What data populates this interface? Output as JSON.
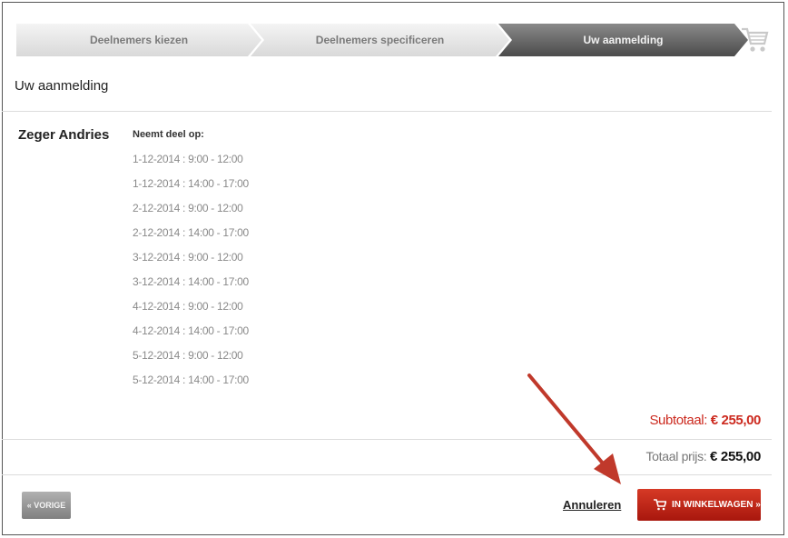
{
  "steps": [
    {
      "label": "Deelnemers kiezen",
      "state": "done"
    },
    {
      "label": "Deelnemers specificeren",
      "state": "done"
    },
    {
      "label": "Uw aanmelding",
      "state": "active"
    }
  ],
  "cart_icon": "shopping-cart-icon",
  "page_title": "Uw aanmelding",
  "participant": {
    "name": "Zeger Andries",
    "takes_part_label": "Neemt deel op:",
    "sessions": [
      "1-12-2014 : 9:00 - 12:00",
      "1-12-2014 : 14:00 - 17:00",
      "2-12-2014 : 9:00 - 12:00",
      "2-12-2014 : 14:00 - 17:00",
      "3-12-2014 : 9:00 - 12:00",
      "3-12-2014 : 14:00 - 17:00",
      "4-12-2014 : 9:00 - 12:00",
      "4-12-2014 : 14:00 - 17:00",
      "5-12-2014 : 9:00 - 12:00",
      "5-12-2014 : 14:00 - 17:00"
    ]
  },
  "subtotal": {
    "label": "Subtotaal:",
    "amount": "€ 255,00"
  },
  "total": {
    "label": "Totaal prijs:",
    "amount": "€ 255,00"
  },
  "buttons": {
    "previous": "« VORIGE",
    "cancel": "Annuleren",
    "add_to_cart": "IN WINKELWAGEN »"
  },
  "colors": {
    "accent_red": "#c0261a",
    "active_step": "#5a5a5a",
    "annotation_arrow": "#c0392b"
  }
}
